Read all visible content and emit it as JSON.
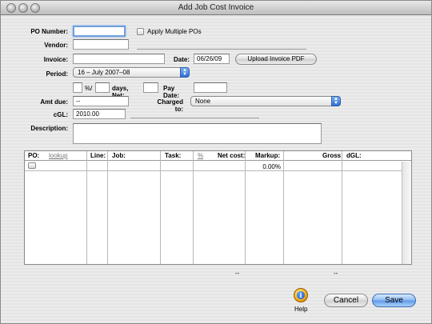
{
  "window": {
    "title": "Add Job Cost Invoice"
  },
  "form": {
    "po_number_label": "PO Number:",
    "po_number_value": "",
    "apply_multiple_label": "Apply Multiple POs",
    "vendor_label": "Vendor:",
    "vendor_value": "",
    "invoice_label": "Invoice:",
    "invoice_value": "",
    "date_label": "Date:",
    "date_value": "06/26/09",
    "upload_button": "Upload Invoice PDF",
    "period_label": "Period:",
    "period_value": "16 – July 2007–08",
    "percent_value": "",
    "percent_suffix": "%/",
    "days_value": "",
    "days_net_label": "days, Net:",
    "net_value": "",
    "pay_date_label": "Pay Date:",
    "pay_date_value": "",
    "amt_due_label": "Amt due:",
    "amt_due_value": "--",
    "charged_to_label": "Charged to:",
    "charged_to_value": "None",
    "cgl_label": "cGL:",
    "cgl_value": "2010.00",
    "description_label": "Description:",
    "description_value": ""
  },
  "table": {
    "headers": {
      "po": "PO:",
      "lookup": "lookup",
      "line": "Line:",
      "job": "Job:",
      "task": "Task:",
      "percent": "%",
      "net_cost": "Net cost:",
      "markup": "Markup:",
      "gross": "Gross:",
      "dgl": "dGL:"
    },
    "rows": [
      {
        "markup": "0.00%"
      }
    ],
    "totals": {
      "net_cost": "--",
      "gross": "--"
    }
  },
  "footer": {
    "help_label": "Help",
    "cancel_button": "Cancel",
    "save_button": "Save"
  }
}
